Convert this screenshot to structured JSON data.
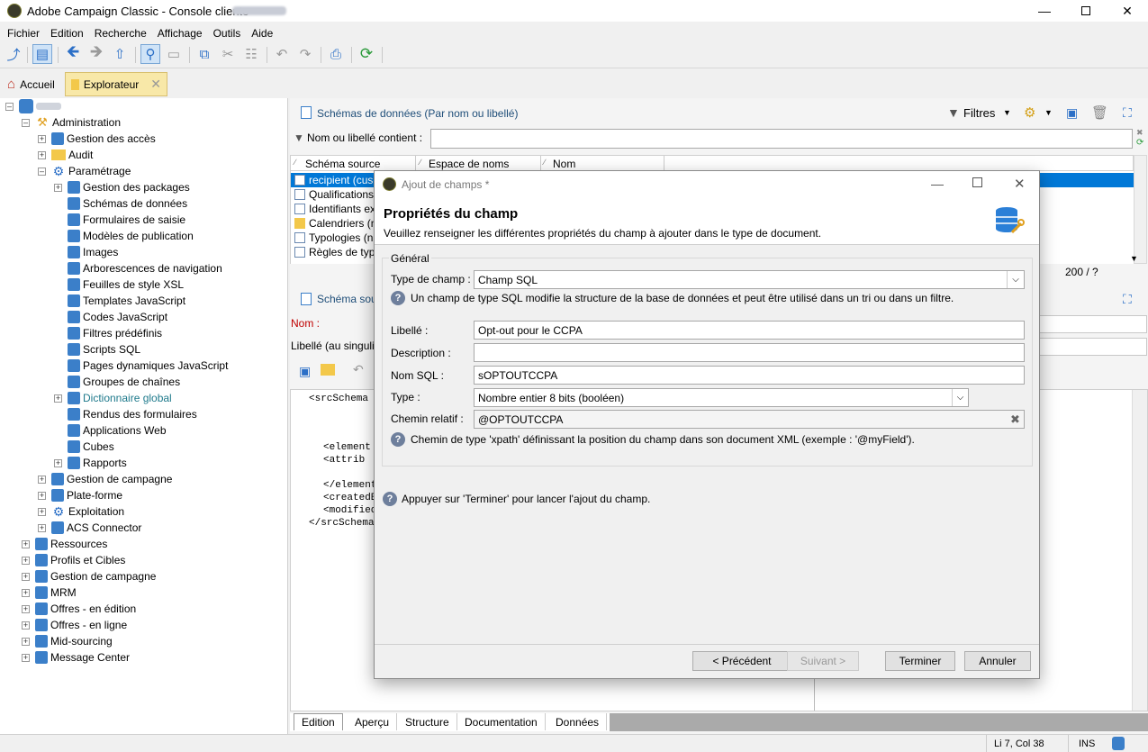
{
  "window": {
    "title": "Adobe Campaign Classic - Console cliente"
  },
  "menu": [
    "Fichier",
    "Edition",
    "Recherche",
    "Affichage",
    "Outils",
    "Aide"
  ],
  "tabs": {
    "home": "Accueil",
    "explorer": "Explorateur"
  },
  "tree": {
    "items": [
      {
        "label": "Administration",
        "icon": "wrench-icon"
      },
      {
        "label": "Gestion des accès",
        "icon": "user-access-icon"
      },
      {
        "label": "Audit",
        "icon": "folder-icon"
      },
      {
        "label": "Paramétrage",
        "icon": "gear-icon"
      },
      {
        "label": "Gestion des packages",
        "icon": "package-icon"
      },
      {
        "label": "Schémas de données",
        "icon": "schema-icon"
      },
      {
        "label": "Formulaires de saisie",
        "icon": "form-icon"
      },
      {
        "label": "Modèles de publication",
        "icon": "publication-icon"
      },
      {
        "label": "Images",
        "icon": "image-icon"
      },
      {
        "label": "Arborescences de navigation",
        "icon": "tree-icon"
      },
      {
        "label": "Feuilles de style XSL",
        "icon": "xsl-icon"
      },
      {
        "label": "Templates JavaScript",
        "icon": "js-template-icon"
      },
      {
        "label": "Codes JavaScript",
        "icon": "js-code-icon"
      },
      {
        "label": "Filtres prédéfinis",
        "icon": "filter-icon"
      },
      {
        "label": "Scripts SQL",
        "icon": "sql-icon"
      },
      {
        "label": "Pages dynamiques JavaScript",
        "icon": "dynamic-page-icon"
      },
      {
        "label": "Groupes de chaînes",
        "icon": "string-group-icon"
      },
      {
        "label": "Dictionnaire global",
        "icon": "dictionary-icon"
      },
      {
        "label": "Rendus des formulaires",
        "icon": "form-render-icon"
      },
      {
        "label": "Applications Web",
        "icon": "web-app-icon"
      },
      {
        "label": "Cubes",
        "icon": "cube-icon"
      },
      {
        "label": "Rapports",
        "icon": "report-icon"
      },
      {
        "label": "Gestion de campagne",
        "icon": "campaign-icon"
      },
      {
        "label": "Plate-forme",
        "icon": "platform-icon"
      },
      {
        "label": "Exploitation",
        "icon": "gear-icon"
      },
      {
        "label": "ACS Connector",
        "icon": "acs-icon"
      },
      {
        "label": "Ressources",
        "icon": "resources-icon"
      },
      {
        "label": "Profils et Cibles",
        "icon": "profiles-icon"
      },
      {
        "label": "Gestion de campagne",
        "icon": "campaign-icon"
      },
      {
        "label": "MRM",
        "icon": "mrm-icon"
      },
      {
        "label": "Offres - en édition",
        "icon": "offer-icon"
      },
      {
        "label": "Offres - en ligne",
        "icon": "offer-icon"
      },
      {
        "label": "Mid-sourcing",
        "icon": "database-icon"
      },
      {
        "label": "Message Center",
        "icon": "message-icon"
      }
    ]
  },
  "panel": {
    "title": "Schémas de données (Par nom ou libellé)",
    "filters_label": "Filtres",
    "filter_label": "Nom ou libellé contient :",
    "filter_value": "",
    "columns": [
      "Schéma source",
      "Espace de noms",
      "Nom"
    ],
    "rows": [
      "recipient (cus",
      "Qualifications",
      "Identifiants ex",
      "Calendriers (n",
      "Typologies (n",
      "Règles de typ"
    ],
    "count": "200 / ?",
    "section_title": "Schéma sou",
    "name_label": "Nom :",
    "singular_label": "Libellé (au singuli"
  },
  "editor": {
    "lines": [
      "<srcSchema",
      "",
      "",
      "",
      "<element",
      "  <attrib",
      "",
      "</element",
      "<createdB",
      "<modified",
      "</srcSchema"
    ]
  },
  "bottom_tabs": [
    "Edition",
    "Aperçu",
    "Structure",
    "Documentation",
    "Données"
  ],
  "status": {
    "position": "Li 7, Col 38",
    "mode": "INS"
  },
  "dialog": {
    "title": "Ajout de champs *",
    "heading": "Propriétés du champ",
    "subtitle": "Veuillez renseigner les différentes propriétés du champ à ajouter dans le type de document.",
    "group": "Général",
    "field_type_label": "Type de champ :",
    "field_type_value": "Champ SQL",
    "field_type_help": "Un champ de type SQL modifie la structure de la base de données et peut être utilisé dans un tri ou dans un filtre.",
    "label_label": "Libellé :",
    "label_value": "Opt-out pour le CCPA",
    "description_label": "Description :",
    "description_value": "",
    "sqlname_label": "Nom SQL :",
    "sqlname_value": "sOPTOUTCCPA",
    "type_label": "Type :",
    "type_value": "Nombre entier 8 bits (booléen)",
    "path_label": "Chemin relatif :",
    "path_value": "@OPTOUTCCPA",
    "path_help": "Chemin de type 'xpath' définissant la position du champ dans son document XML (exemple : '@myField').",
    "finish_help": "Appuyer sur 'Terminer' pour lancer l'ajout du champ.",
    "btn_prev": "< Précédent",
    "btn_next": "Suivant >",
    "btn_finish": "Terminer",
    "btn_cancel": "Annuler"
  }
}
